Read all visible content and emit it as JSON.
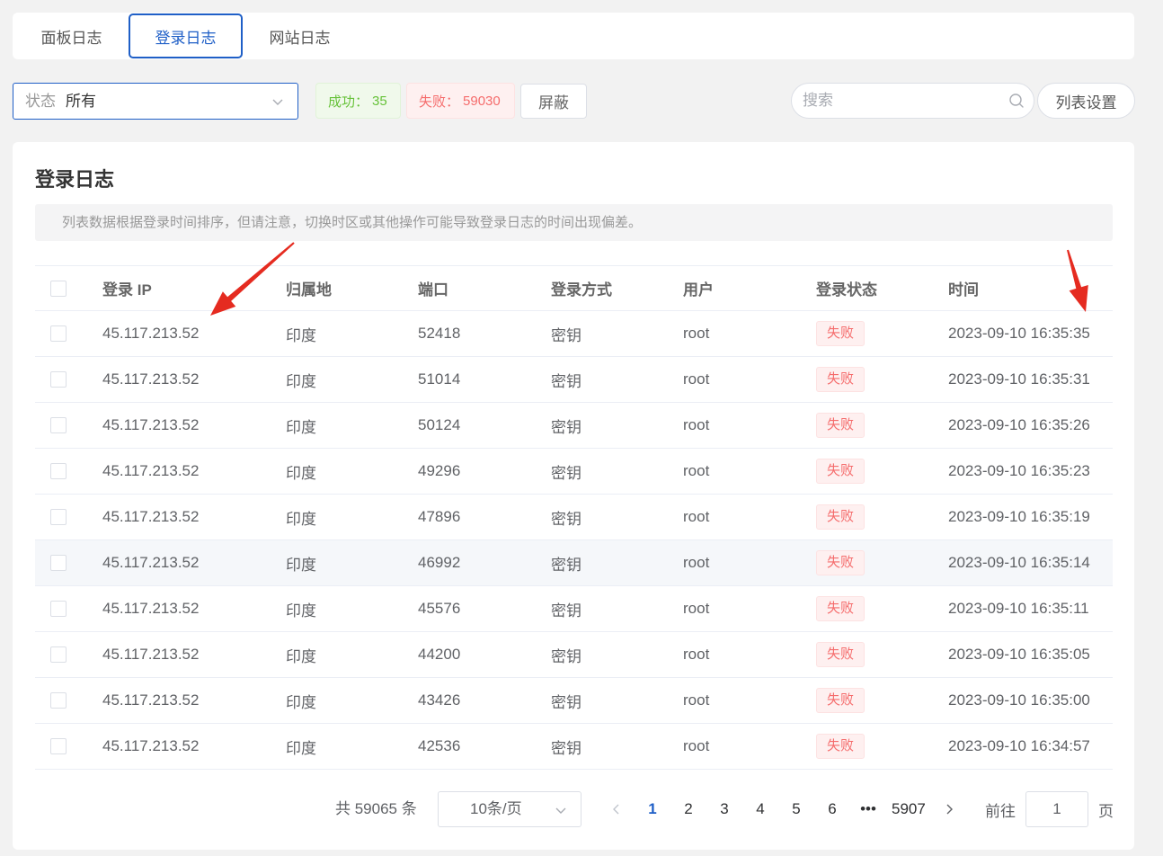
{
  "colors": {
    "accent": "#1f5fc7",
    "success": "#67c23a",
    "danger": "#f56c6c",
    "annotation": "#e52b20"
  },
  "tabs": [
    {
      "label": "面板日志",
      "active": false
    },
    {
      "label": "登录日志",
      "active": true
    },
    {
      "label": "网站日志",
      "active": false
    }
  ],
  "filter": {
    "status_label": "状态",
    "status_value": "所有",
    "success_label": "成功：",
    "success_count": "35",
    "fail_label": "失败：",
    "fail_count": "59030",
    "block_button": "屏蔽",
    "search_placeholder": "搜索",
    "list_settings_button": "列表设置"
  },
  "panel": {
    "title": "登录日志",
    "notice": "列表数据根据登录时间排序，但请注意，切换时区或其他操作可能导致登录日志的时间出现偏差。"
  },
  "table": {
    "columns": [
      "登录 IP",
      "归属地",
      "端口",
      "登录方式",
      "用户",
      "登录状态",
      "时间"
    ],
    "rows": [
      {
        "ip": "45.117.213.52",
        "location": "印度",
        "port": "52418",
        "method": "密钥",
        "user": "root",
        "status": "失败",
        "time": "2023-09-10 16:35:35"
      },
      {
        "ip": "45.117.213.52",
        "location": "印度",
        "port": "51014",
        "method": "密钥",
        "user": "root",
        "status": "失败",
        "time": "2023-09-10 16:35:31"
      },
      {
        "ip": "45.117.213.52",
        "location": "印度",
        "port": "50124",
        "method": "密钥",
        "user": "root",
        "status": "失败",
        "time": "2023-09-10 16:35:26"
      },
      {
        "ip": "45.117.213.52",
        "location": "印度",
        "port": "49296",
        "method": "密钥",
        "user": "root",
        "status": "失败",
        "time": "2023-09-10 16:35:23"
      },
      {
        "ip": "45.117.213.52",
        "location": "印度",
        "port": "47896",
        "method": "密钥",
        "user": "root",
        "status": "失败",
        "time": "2023-09-10 16:35:19"
      },
      {
        "ip": "45.117.213.52",
        "location": "印度",
        "port": "46992",
        "method": "密钥",
        "user": "root",
        "status": "失败",
        "time": "2023-09-10 16:35:14",
        "hovered": true
      },
      {
        "ip": "45.117.213.52",
        "location": "印度",
        "port": "45576",
        "method": "密钥",
        "user": "root",
        "status": "失败",
        "time": "2023-09-10 16:35:11"
      },
      {
        "ip": "45.117.213.52",
        "location": "印度",
        "port": "44200",
        "method": "密钥",
        "user": "root",
        "status": "失败",
        "time": "2023-09-10 16:35:05"
      },
      {
        "ip": "45.117.213.52",
        "location": "印度",
        "port": "43426",
        "method": "密钥",
        "user": "root",
        "status": "失败",
        "time": "2023-09-10 16:35:00"
      },
      {
        "ip": "45.117.213.52",
        "location": "印度",
        "port": "42536",
        "method": "密钥",
        "user": "root",
        "status": "失败",
        "time": "2023-09-10 16:34:57"
      }
    ]
  },
  "pagination": {
    "total_text": "共 59065 条",
    "page_size": "10条/页",
    "pages": [
      {
        "label": "1",
        "active": true
      },
      {
        "label": "2",
        "active": false
      },
      {
        "label": "3",
        "active": false
      },
      {
        "label": "4",
        "active": false
      },
      {
        "label": "5",
        "active": false
      },
      {
        "label": "6",
        "active": false
      },
      {
        "label": "•••",
        "active": false
      },
      {
        "label": "5907",
        "active": false
      }
    ],
    "goto_label": "前往",
    "goto_value": "1",
    "page_suffix": "页"
  },
  "icons": {
    "select_chevron": "chevron-down-icon",
    "search": "search-icon",
    "prev": "chevron-left-icon",
    "next": "chevron-right-icon"
  }
}
